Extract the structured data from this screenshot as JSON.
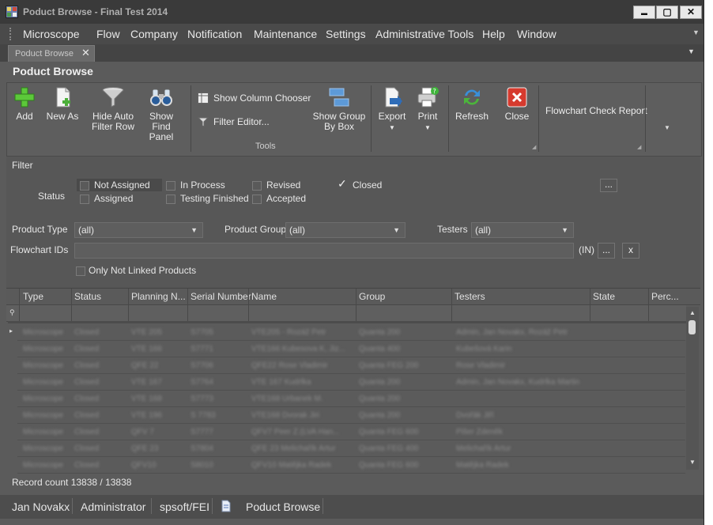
{
  "window": {
    "title": "Poduct Browse - Final Test 2014",
    "min": "▬",
    "max": "▢",
    "close": "✕"
  },
  "menu": {
    "items": [
      "Microscope",
      "Flow",
      "Company",
      "Notification",
      "Maintenance",
      "Settings",
      "Administrative Tools",
      "Help",
      "Window"
    ]
  },
  "tab": {
    "label": "Poduct Browse",
    "close": "✕"
  },
  "page": {
    "title": "Poduct Browse"
  },
  "toolbar": {
    "add": "Add",
    "new_as": "New As",
    "hide_auto_1": "Hide Auto",
    "hide_auto_2": "Filter Row",
    "show_find_1": "Show Find",
    "show_find_2": "Panel",
    "show_column_chooser": "Show Column Chooser",
    "filter_editor": "Filter Editor...",
    "show_group_1": "Show Group",
    "show_group_2": "By Box",
    "export": "Export",
    "print": "Print",
    "refresh": "Refresh",
    "close": "Close",
    "flowchart_check_report": "Flowchart Check Report",
    "group_label": "Tools"
  },
  "filter": {
    "title": "Filter",
    "status_label": "Status",
    "statuses": [
      {
        "label": "Not Assigned",
        "checked": false
      },
      {
        "label": "Assigned",
        "checked": false
      },
      {
        "label": "In Process",
        "checked": false
      },
      {
        "label": "Testing Finished",
        "checked": false
      },
      {
        "label": "Revised",
        "checked": false
      },
      {
        "label": "Accepted",
        "checked": false
      },
      {
        "label": "Closed",
        "checked": true
      }
    ],
    "ellipsis": "...",
    "product_type_label": "Product Type",
    "product_type_value": "(all)",
    "product_group_label": "Product Group",
    "product_group_value": "(all)",
    "testers_label": "Testers",
    "testers_value": "(all)",
    "flowchart_ids_label": "Flowchart IDs",
    "flowchart_ids_value": "",
    "in_label": "(IN)",
    "clear": "x",
    "only_not_linked": "Only Not Linked Products"
  },
  "grid": {
    "columns": [
      "Type",
      "Status",
      "Planning N...",
      "Serial Number",
      "Name",
      "Group",
      "Testers",
      "State",
      "Perc..."
    ],
    "rows": [
      [
        "Microscope",
        "Closed",
        "VTE 205",
        "S7705",
        "VTE205 - Rozáž Petr",
        "Quanta 200",
        "Admin, Jan Novakx, Rozáž Petr"
      ],
      [
        "Microscope",
        "Closed",
        "VTE 166",
        "S7771",
        "VTE166 Kubesova K, Jiz...",
        "Quanta 400",
        "Kubešová Karin"
      ],
      [
        "Microscope",
        "Closed",
        "QFE 22",
        "S7706",
        "QFE22 Rose Vladimir",
        "Quanta FEG 200",
        "Rose Vladimir"
      ],
      [
        "Microscope",
        "Closed",
        "VTE 167",
        "S7764",
        "VTE 167 Kudrlka",
        "Quanta 200",
        "Admin, Jan Novakx, Kudrlka Martin"
      ],
      [
        "Microscope",
        "Closed",
        "VTE 168",
        "S7773",
        "VTE168 Urbanek M.",
        "Quanta 200",
        ""
      ],
      [
        "Microscope",
        "Closed",
        "VTE 196",
        "S 7783",
        "VTE168 Dvorak Jiri",
        "Quanta 200",
        "Dvořák Jiří"
      ],
      [
        "Microscope",
        "Closed",
        "QFV 7",
        "S7777",
        "QFV7 Peer Z.(LVA Han...",
        "Quanta FEG 600",
        "Pišer Zdeněk"
      ],
      [
        "Microscope",
        "Closed",
        "QFE 23",
        "S7804",
        "QFE 23 Melichařík Artur",
        "Quanta FEG 400",
        "Melichařík Artur"
      ],
      [
        "Microscope",
        "Closed",
        "QFV10",
        "S8010",
        "QFV10 Matějka Radek",
        "Quanta FEG 600",
        "Matějka Radek"
      ]
    ]
  },
  "record_count": "Record count 13838 / 13838",
  "status": {
    "user": "Jan Novakx",
    "role": "Administrator",
    "domain": "spsoft/FEI",
    "view": "Poduct Browse"
  }
}
